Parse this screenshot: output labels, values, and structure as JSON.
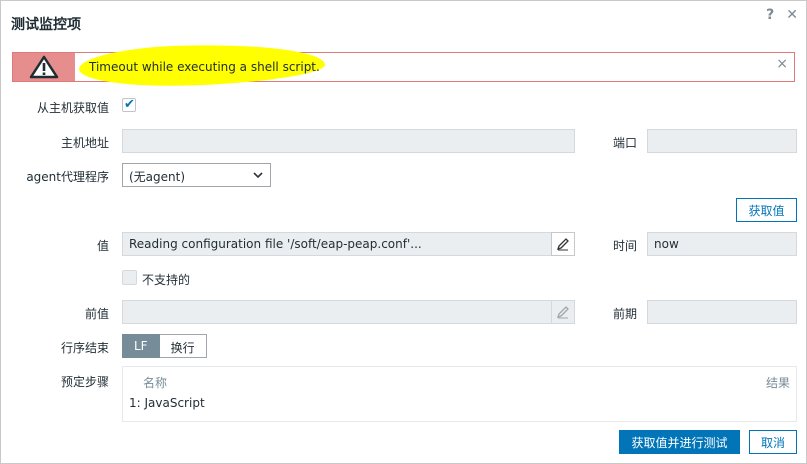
{
  "dialog": {
    "title": "测试监控项",
    "help_icon": "?",
    "close_icon": "✕"
  },
  "alert": {
    "message": "Timeout while executing a shell script.",
    "close_icon": "×",
    "colors": {
      "icon_bg": "#e68d8d",
      "border": "#e07a7a",
      "highlight": "#ffff00"
    }
  },
  "form": {
    "get_from_host_label": "从主机获取值",
    "get_from_host_checked": true,
    "host_address_label": "主机地址",
    "host_address_value": "",
    "port_label": "端口",
    "port_value": "",
    "agent_proxy_label": "agent代理程序",
    "agent_proxy_value": "(无agent)",
    "get_value_button": "获取值",
    "value_label": "值",
    "value_text": "Reading configuration file '/soft/eap-peap.conf'...",
    "time_label": "时间",
    "time_value": "now",
    "not_supported_label": "不支持的",
    "prev_value_label": "前值",
    "prev_value_text": "",
    "prev_time_label": "前期",
    "prev_time_value": "",
    "eol_label": "行序结束",
    "eol_options": [
      "LF",
      "换行"
    ],
    "preprocessing_label": "预定步骤",
    "preprocessing": {
      "col_name": "名称",
      "col_result": "结果",
      "rows": [
        "1: JavaScript"
      ]
    }
  },
  "footer": {
    "test_button": "获取值并进行测试",
    "cancel_button": "取消"
  },
  "colors": {
    "primary": "#0275b8",
    "segment_active": "#768d99"
  }
}
